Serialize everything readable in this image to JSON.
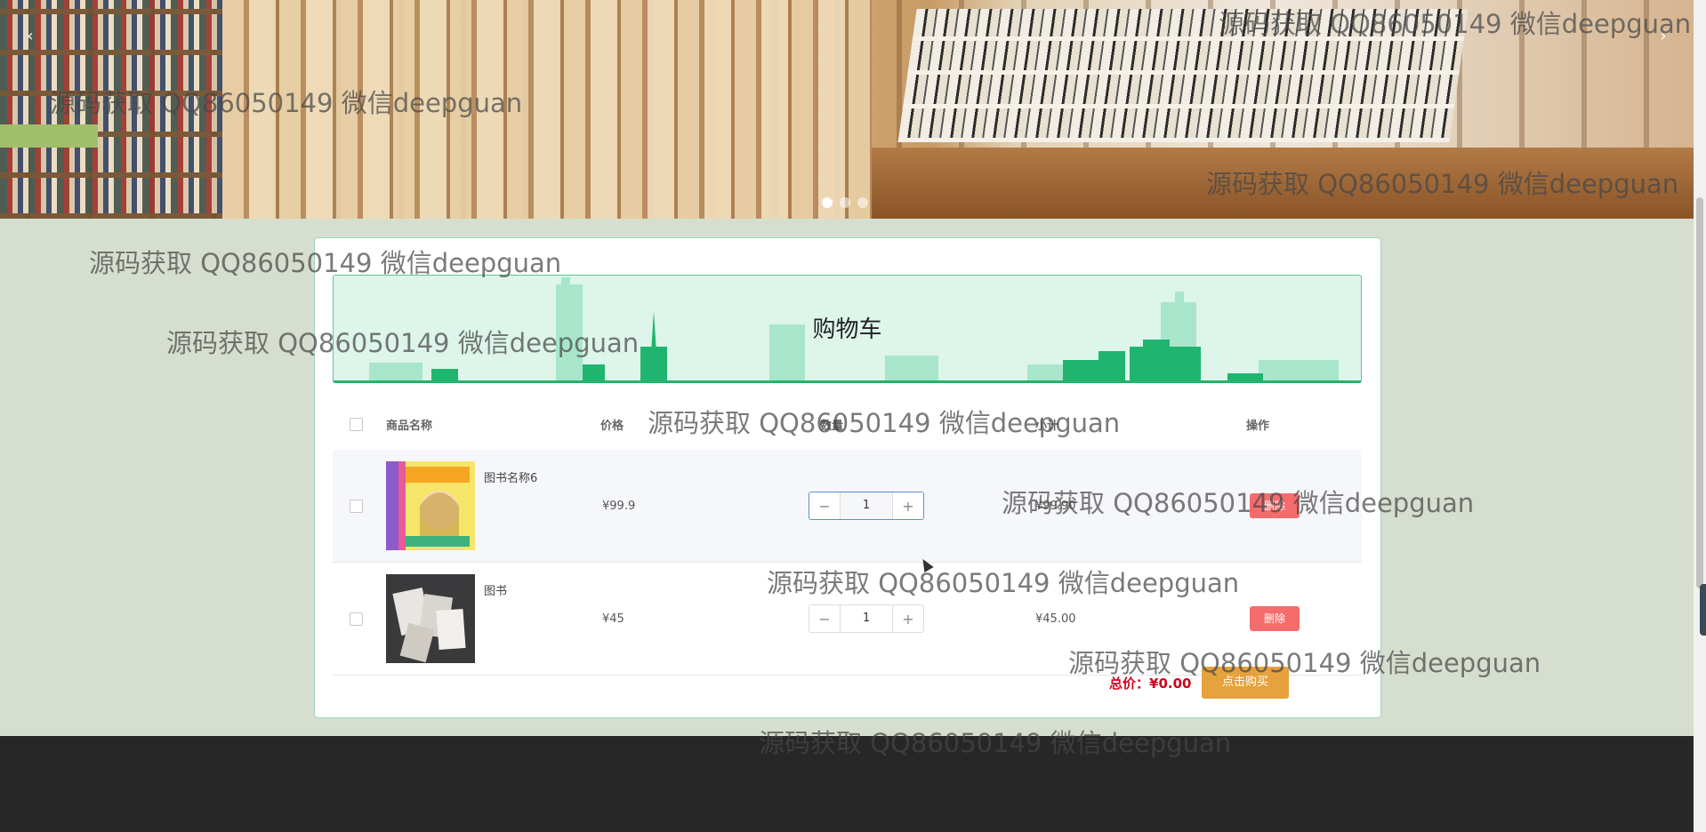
{
  "banner": {
    "prev_glyph": "‹",
    "next_glyph": "›",
    "slide_count": 3,
    "active_slide": 1
  },
  "cart": {
    "title": "购物车",
    "columns": {
      "name": "商品名称",
      "price": "价格",
      "quantity": "数量",
      "subtotal": "小计",
      "action": "操作"
    },
    "items": [
      {
        "name": "图书名称6",
        "price": "¥99.9",
        "quantity": "1",
        "subtotal": "¥99.90",
        "delete_label": "删除"
      },
      {
        "name": "图书",
        "price": "¥45",
        "quantity": "1",
        "subtotal": "¥45.00",
        "delete_label": "删除"
      }
    ],
    "total_label": "总价：",
    "total_value": "¥0.00",
    "buy_label": "点击购买"
  },
  "stepper": {
    "minus": "−",
    "plus": "+"
  },
  "watermark": "源码获取 QQ86050149 微信deepguan",
  "colors": {
    "accent_green": "#23b36a",
    "delete_red": "#f56c6c",
    "buy_orange": "#e6a23c",
    "total_red": "#d0021b",
    "footer": "#272727"
  }
}
